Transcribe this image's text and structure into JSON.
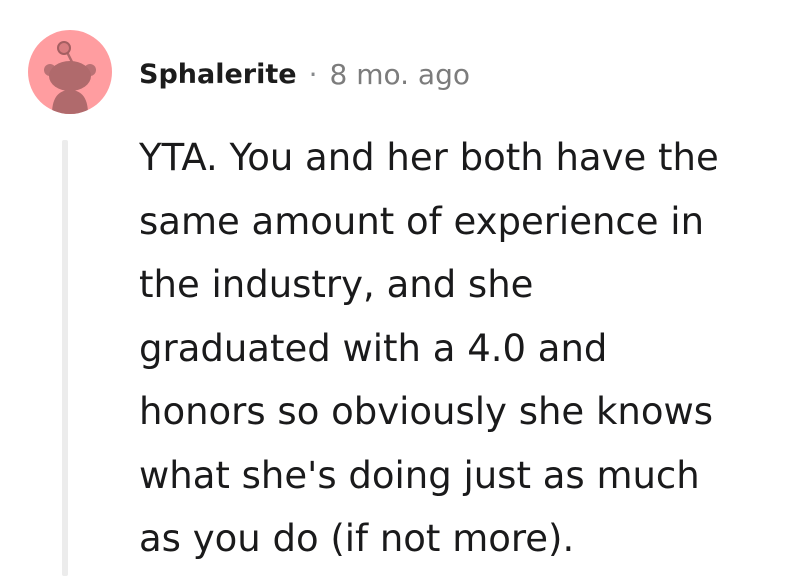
{
  "comment": {
    "author": "Sphalerite",
    "separator": "·",
    "timestamp": "8 mo. ago",
    "avatar_icon": "snoo-avatar-icon",
    "avatar_color": "#ff9da0",
    "body_lines": [
      "YTA. You and her both have the",
      "same amount of experience in",
      "the industry, and she",
      "graduated with a 4.0 and",
      "honors so obviously she knows",
      "what she's doing just as much",
      "as you do (if not more)."
    ]
  }
}
